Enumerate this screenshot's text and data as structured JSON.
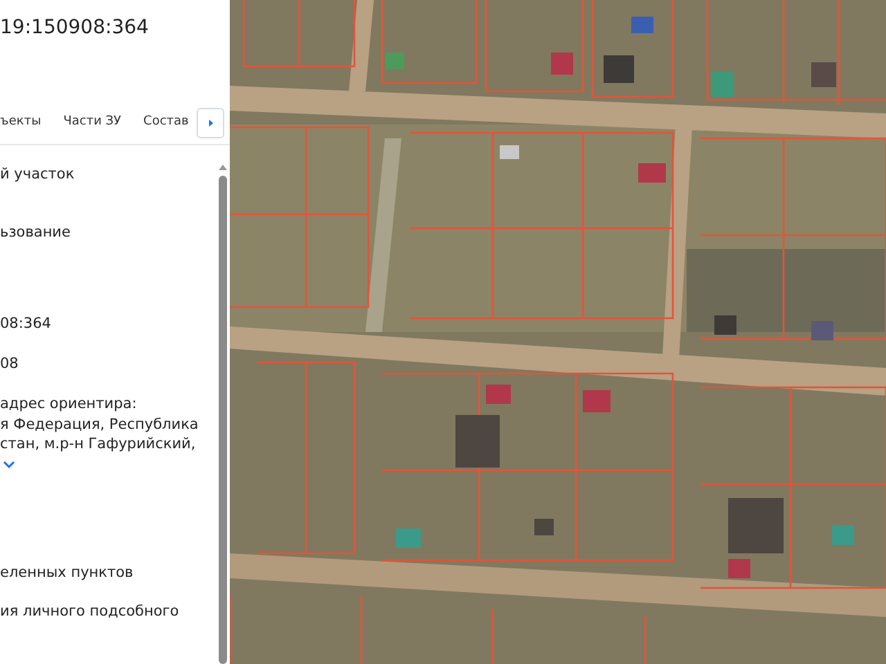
{
  "parcel": {
    "number": "19:150908:364"
  },
  "tabs": [
    {
      "label": "ъекты",
      "selected": false
    },
    {
      "label": "Части ЗУ",
      "selected": false
    },
    {
      "label": "Состав",
      "selected": false
    }
  ],
  "fields": [
    {
      "lines": [
        "й участок"
      ],
      "expandable": false
    },
    {
      "lines": [
        "ьзование"
      ],
      "expandable": false
    },
    {
      "lines": [
        "08:364"
      ],
      "expandable": false
    },
    {
      "lines": [
        "08"
      ],
      "expandable": false
    },
    {
      "lines": [
        "адрес ориентира:",
        "я Федерация, Республика",
        "стан, м.р-н Гафурийский,"
      ],
      "expandable": true
    },
    {
      "lines": [
        "еленных пунктов"
      ],
      "expandable": false
    },
    {
      "lines": [
        "ия личного подсобного"
      ],
      "expandable": false
    }
  ]
}
